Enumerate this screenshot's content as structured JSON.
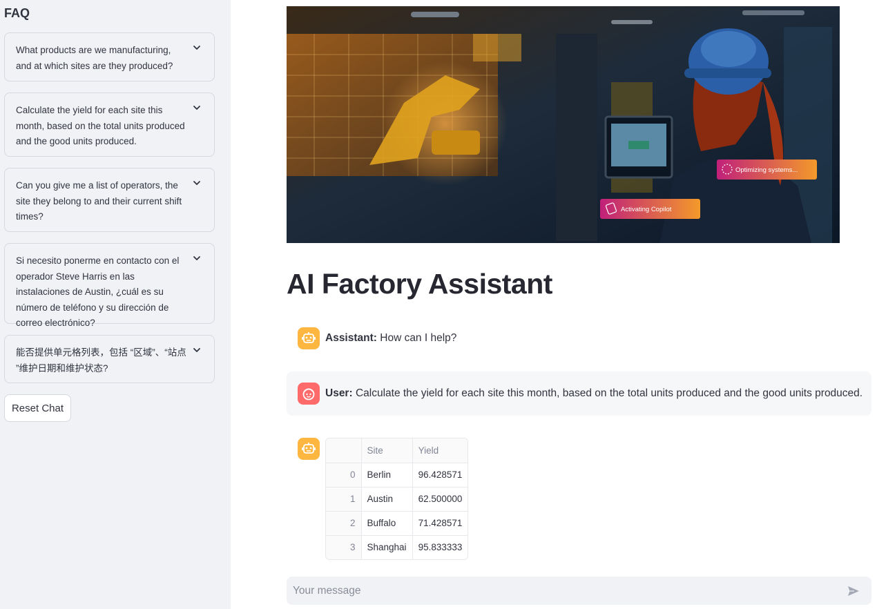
{
  "sidebar": {
    "title": "FAQ",
    "faq": [
      {
        "question": "What products are we manufacturing, and at which sites are they produced?"
      },
      {
        "question": "Calculate the yield for each site this month, based on the total units produced and the good units produced."
      },
      {
        "question": "Can you give me a list of operators, the site they belong to and their current shift times?"
      },
      {
        "question": "Si necesito ponerme en contacto con el operador Steve Harris en las instalaciones de Austin, ¿cuál es su número de teléfono y su dirección de correo electrónico?"
      },
      {
        "question": "能否提供单元格列表，包括 “区域”、“站点 ”维护日期和维护状态?"
      }
    ],
    "reset_label": "Reset Chat"
  },
  "hero": {
    "badge_optimizing": "Optimizing systems...",
    "badge_copilot": "Activating Copilot"
  },
  "main": {
    "title": "AI Factory Assistant"
  },
  "chat": {
    "messages": [
      {
        "role": "Assistant:",
        "text": "How can I help?"
      },
      {
        "role": "User:",
        "text": "Calculate the yield for each site this month, based on the total units produced and the good units produced."
      }
    ],
    "table": {
      "columns": [
        "",
        "Site",
        "Yield"
      ],
      "rows": [
        {
          "index": "0",
          "site": "Berlin",
          "yield": "96.428571"
        },
        {
          "index": "1",
          "site": "Austin",
          "yield": "62.500000"
        },
        {
          "index": "2",
          "site": "Buffalo",
          "yield": "71.428571"
        },
        {
          "index": "3",
          "site": "Shanghai",
          "yield": "95.833333"
        }
      ]
    },
    "input_placeholder": "Your message"
  },
  "colors": {
    "sidebar_bg": "#f0f2f6",
    "assistant_avatar": "#fdb740",
    "user_avatar": "#ff6b6b"
  }
}
